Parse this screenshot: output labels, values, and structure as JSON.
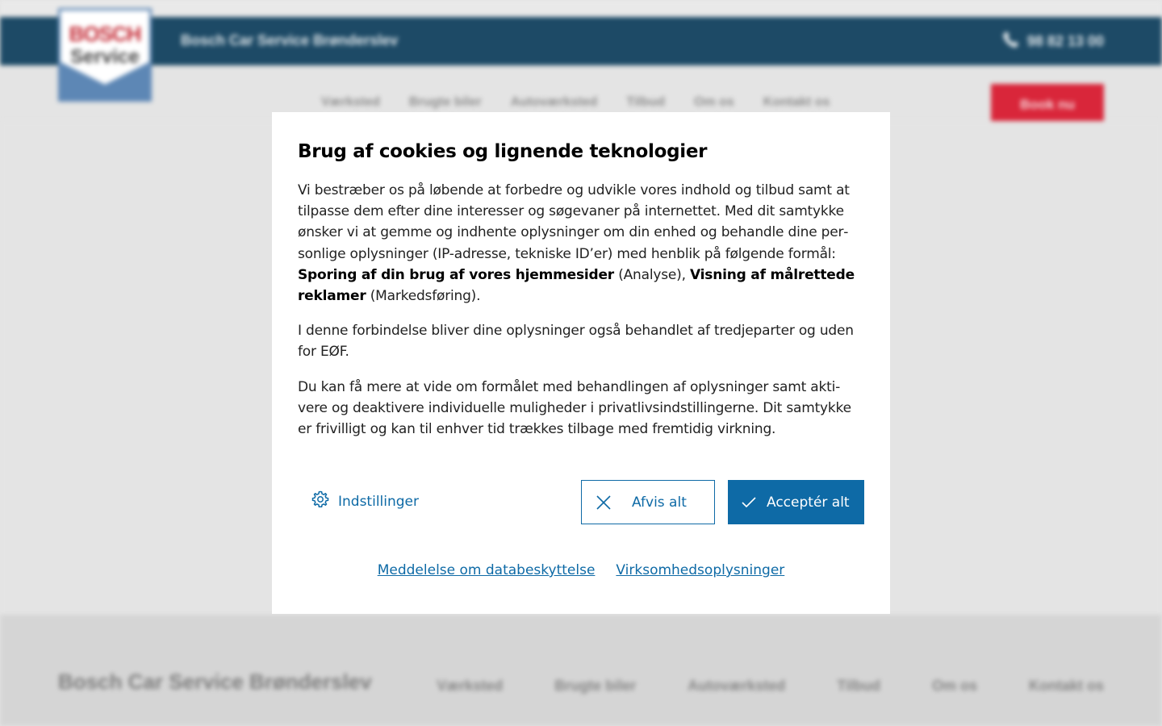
{
  "background": {
    "header_title": "Bosch Car Service Brønderslev",
    "phone": "98 82 13 00",
    "logo": {
      "brand": "BOSCH",
      "sub": "Service"
    },
    "nav": [
      "Værksted",
      "Brugte biler",
      "Autoværksted",
      "Tilbud",
      "Om os",
      "Kontakt os"
    ],
    "book_button": "Book nu",
    "footer_title": "Bosch Car Service Brønderslev",
    "footer_nav": [
      "Værksted",
      "Brugte biler",
      "Autoværksted",
      "Tilbud",
      "Om os",
      "Kontakt os"
    ]
  },
  "modal": {
    "title": "Brug af cookies og lignende teknologier",
    "p1_intro": "Vi bestræber os på løbende at forbedre og udvikle vores indhold og tilbud samt at tilpasse dem efter dine interesser og søgevaner på internettet. Med dit samtykke ønsker vi at gemme og indhente oplysninger om din enhed og behandle dine per­sonlige oplysninger (IP-adresse, tekniske ID’er) med henblik på følgende formål: ",
    "purpose1": "Sporing af din brug af vores hjemmesider",
    "purpose1_tag": " (Analyse), ",
    "purpose2": "Visning af målrettede rekla­mer",
    "purpose2_tag": " (Markedsføring).",
    "p2": "I denne forbindelse bliver dine oplysninger også behandlet af tredjeparter og uden for EØF.",
    "p3": "Du kan få mere at vide om formålet med behandlingen af oplysninger samt akti­vere og deaktivere individuelle muligheder i privatlivsindstillingerne. Dit samtykke er frivilligt og kan til enhver tid trækkes tilbage med fremtidig virkning.",
    "settings_label": "Indstillinger",
    "reject_label": "Afvis alt",
    "accept_label": "Acceptér alt",
    "link_privacy": "Meddelelse om databeskyttelse",
    "link_company": "Virksomhedsoplysninger"
  },
  "colors": {
    "primary_blue": "#0e6aa6",
    "header_navy": "#1d4a66",
    "book_red": "#d9263a"
  },
  "icons": [
    "gear-icon",
    "close-icon",
    "check-icon",
    "phone-icon"
  ]
}
